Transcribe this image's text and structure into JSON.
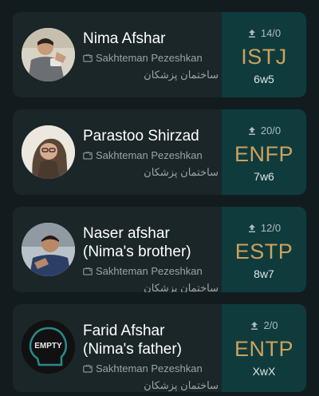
{
  "characters": [
    {
      "name_lines": [
        "Nima Afshar"
      ],
      "show_en": "Sakhteman Pezeshkan",
      "show_fa": "ساختمان پزشکان",
      "votes": "14/0",
      "mbti": "ISTJ",
      "enneagram": "6w5"
    },
    {
      "name_lines": [
        "Parastoo Shirzad"
      ],
      "show_en": "Sakhteman Pezeshkan",
      "show_fa": "ساختمان پزشکان",
      "votes": "20/0",
      "mbti": "ENFP",
      "enneagram": "7w6"
    },
    {
      "name_lines": [
        "Naser afshar",
        "(Nima's brother)"
      ],
      "show_en": "Sakhteman Pezeshkan",
      "show_fa": "ساختمان پزشکان",
      "votes": "12/0",
      "mbti": "ESTP",
      "enneagram": "8w7"
    },
    {
      "name_lines": [
        "Farid Afshar",
        "(Nima's father)"
      ],
      "show_en": "Sakhteman Pezeshkan",
      "show_fa": "ساختمان پزشکان",
      "votes": "2/0",
      "mbti": "ENTP",
      "enneagram": "XwX",
      "avatar_placeholder": "EMPTY"
    }
  ],
  "icons": {
    "tv": "tv-icon",
    "votes": "vote-icon"
  },
  "colors": {
    "background": "#121c1e",
    "card": "#1a2628",
    "mbti_panel": "#0f3b3d",
    "mbti_text": "#cda25c"
  }
}
